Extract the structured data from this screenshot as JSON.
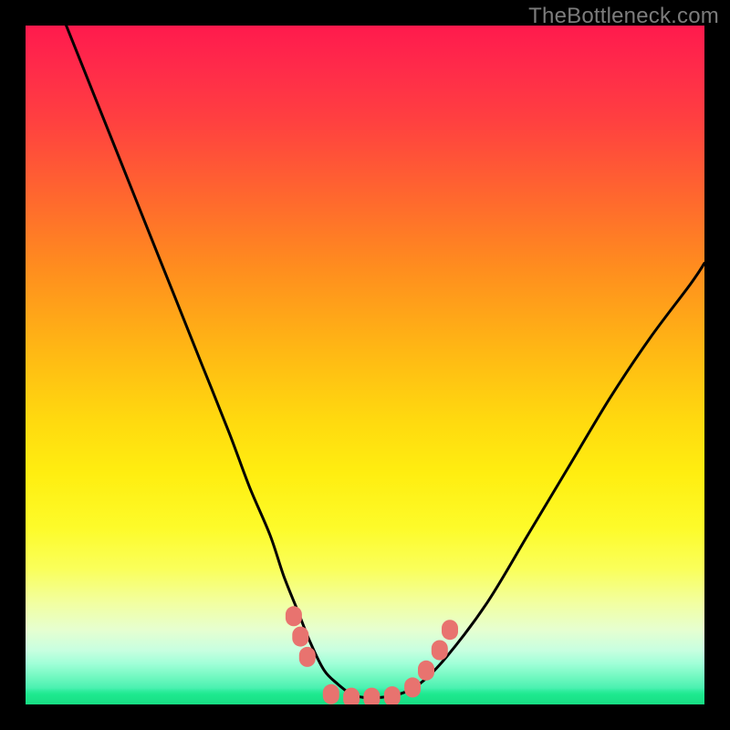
{
  "watermark": "TheBottleneck.com",
  "chart_data": {
    "type": "line",
    "title": "",
    "xlabel": "",
    "ylabel": "",
    "xlim": [
      0,
      100
    ],
    "ylim": [
      0,
      100
    ],
    "grid": false,
    "legend": false,
    "series": [
      {
        "name": "bottleneck-curve",
        "x": [
          6,
          10,
          14,
          18,
          22,
          26,
          30,
          33,
          36,
          38,
          40,
          42,
          44,
          46,
          48,
          50,
          52,
          55,
          58,
          62,
          68,
          74,
          80,
          86,
          92,
          98,
          100
        ],
        "values": [
          100,
          90,
          80,
          70,
          60,
          50,
          40,
          32,
          25,
          19,
          14,
          9,
          5,
          3,
          1.5,
          1,
          1,
          1.5,
          3,
          7,
          15,
          25,
          35,
          45,
          54,
          62,
          65
        ]
      }
    ],
    "markers": {
      "name": "highlighted-points",
      "points": [
        {
          "x": 39.5,
          "y": 13
        },
        {
          "x": 40.5,
          "y": 10
        },
        {
          "x": 41.5,
          "y": 7
        },
        {
          "x": 45,
          "y": 1.5
        },
        {
          "x": 48,
          "y": 1
        },
        {
          "x": 51,
          "y": 1
        },
        {
          "x": 54,
          "y": 1.2
        },
        {
          "x": 57,
          "y": 2.5
        },
        {
          "x": 59,
          "y": 5
        },
        {
          "x": 61,
          "y": 8
        },
        {
          "x": 62.5,
          "y": 11
        }
      ]
    },
    "background_gradient": {
      "top": "#ff1a4d",
      "mid": "#ffee10",
      "bottom": "#1de98e"
    }
  }
}
